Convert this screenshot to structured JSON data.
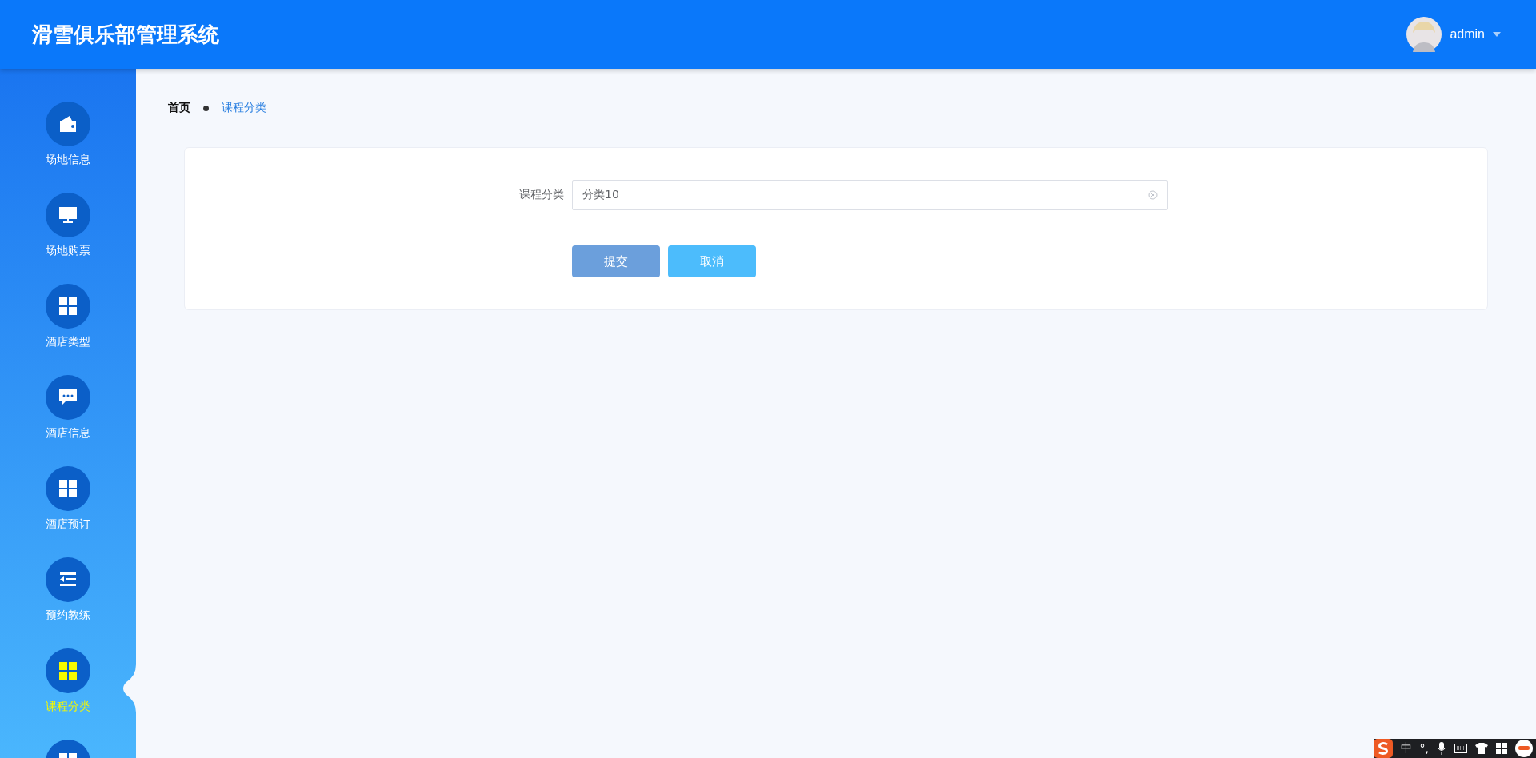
{
  "header": {
    "title": "滑雪俱乐部管理系统",
    "user": {
      "name": "admin"
    }
  },
  "sidebar": {
    "items": [
      {
        "label": "场地信息",
        "selected": false
      },
      {
        "label": "场地购票",
        "selected": false
      },
      {
        "label": "酒店类型",
        "selected": false
      },
      {
        "label": "酒店信息",
        "selected": false
      },
      {
        "label": "酒店预订",
        "selected": false
      },
      {
        "label": "预约教练",
        "selected": false
      },
      {
        "label": "课程分类",
        "selected": true
      },
      {
        "selected": false
      }
    ]
  },
  "breadcrumb": [
    {
      "label": "首页",
      "selected": false
    },
    {
      "label": "课程分类",
      "selected": true
    }
  ],
  "form": {
    "fields": [
      {
        "label": "课程分类",
        "value": "分类10"
      }
    ],
    "buttons": [
      {
        "label": "提交",
        "kind": "submit"
      },
      {
        "label": "取消",
        "kind": "cancel"
      }
    ]
  },
  "ime_toolbar": {
    "mode": "中",
    "punctuation": "°,"
  }
}
